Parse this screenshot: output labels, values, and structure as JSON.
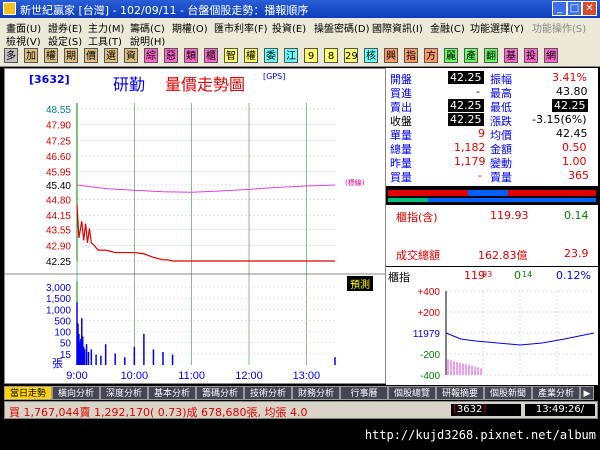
{
  "window": {
    "title": "新世紀贏家 [台灣] - 102/09/11 - 台盤個股走勢：播報順序"
  },
  "menu": {
    "row1": [
      "畫面(U)",
      "證券(E)",
      "主力(M)",
      "籌碼(C)",
      "期權(O)",
      "匯市利率(F)",
      "投資(E)",
      "操盤密碼(D)",
      "國際資訊(I)",
      "金融(C)",
      "功能選擇(Y)",
      "功能操作(S)"
    ],
    "row2": [
      "檢視(V)",
      "設定(S)",
      "工具(T)",
      "說明(H)"
    ]
  },
  "toolbar": {
    "buttons": [
      {
        "label": "多",
        "color": "#c0c0c0"
      },
      {
        "label": "加",
        "color": "#e0c080"
      },
      {
        "label": "權",
        "color": "#e0c080"
      },
      {
        "label": "期",
        "color": "#e0c080"
      },
      {
        "label": "價",
        "color": "#e0c080"
      },
      {
        "label": "選",
        "color": "#e0c080"
      },
      {
        "label": "資",
        "color": "#e0c080"
      },
      {
        "label": "綜",
        "color": "#ff66cc"
      },
      {
        "label": "惡",
        "color": "#ff66cc"
      },
      {
        "label": "類",
        "color": "#ff66cc"
      },
      {
        "label": "櫃",
        "color": "#ff66cc"
      },
      {
        "label": "智",
        "color": "#ffff66"
      },
      {
        "label": "權",
        "color": "#ffff66"
      },
      {
        "label": "委",
        "color": "#66ffff"
      },
      {
        "label": "江",
        "color": "#66ffff"
      },
      {
        "label": "9",
        "color": "#ffff66"
      },
      {
        "label": "8",
        "color": "#ffff66"
      },
      {
        "label": "29",
        "color": "#ffff66"
      },
      {
        "label": "核",
        "color": "#66ffff"
      },
      {
        "label": "興",
        "color": "#ff9966"
      },
      {
        "label": "指",
        "color": "#ff9966"
      },
      {
        "label": "方",
        "color": "#ff9966"
      },
      {
        "label": "麗",
        "color": "#66ff66"
      },
      {
        "label": "產",
        "color": "#66ff66"
      },
      {
        "label": "翻",
        "color": "#66ff66"
      },
      {
        "label": "基",
        "color": "#ff66cc"
      },
      {
        "label": "投",
        "color": "#ff66cc"
      },
      {
        "label": "網",
        "color": "#ff66cc"
      }
    ]
  },
  "chart": {
    "stock_code": "[3632]",
    "stock_name": "研勤",
    "chart_title": "量價走勢圖",
    "gps": "[GPS]",
    "limit_label": "(標線)",
    "forecast_label": "預測",
    "vol_unit": "張"
  },
  "chart_data": {
    "type": "line",
    "title": "量價走勢圖",
    "x_ticks": [
      "9:00",
      "10:00",
      "11:00",
      "12:00",
      "13:00"
    ],
    "price_ticks": [
      48.55,
      47.9,
      47.25,
      46.6,
      45.95,
      45.4,
      44.8,
      44.15,
      43.55,
      42.9,
      42.25
    ],
    "price_ylim": [
      42.25,
      48.55
    ],
    "volume_ticks": [
      3000,
      1500,
      1000,
      500,
      100,
      50,
      15
    ],
    "price_series": {
      "name": "price",
      "x": [
        "9:00",
        "9:02",
        "9:05",
        "9:07",
        "9:09",
        "9:11",
        "9:13",
        "9:15",
        "9:18",
        "9:22",
        "9:30",
        "9:40",
        "9:50",
        "10:00",
        "10:10",
        "10:20",
        "10:25",
        "10:30",
        "10:35",
        "10:40",
        "13:30"
      ],
      "y": [
        44.6,
        43.2,
        43.9,
        43.1,
        43.8,
        43.0,
        43.6,
        43.0,
        42.9,
        42.7,
        42.7,
        42.6,
        42.6,
        42.6,
        42.55,
        42.4,
        42.35,
        42.3,
        42.3,
        42.25,
        42.25
      ]
    },
    "index_series": {
      "name": "index",
      "x": [
        "9:00",
        "9:30",
        "10:00",
        "10:30",
        "11:00",
        "11:30",
        "12:00",
        "12:30",
        "13:00",
        "13:30"
      ],
      "y": [
        45.4,
        45.25,
        45.18,
        45.12,
        45.1,
        45.15,
        45.22,
        45.3,
        45.36,
        45.4
      ]
    },
    "volume_series": {
      "name": "volume",
      "x": [
        "9:00",
        "9:01",
        "9:02",
        "9:03",
        "9:04",
        "9:05",
        "9:06",
        "9:07",
        "9:08",
        "9:10",
        "9:12",
        "9:15",
        "9:20",
        "9:25",
        "9:30",
        "9:40",
        "9:50",
        "10:00",
        "10:10",
        "10:20",
        "10:30",
        "10:40",
        "13:30"
      ],
      "values": [
        120,
        80,
        60,
        45,
        50,
        90,
        55,
        35,
        30,
        40,
        25,
        30,
        20,
        18,
        40,
        22,
        15,
        35,
        60,
        30,
        25,
        20,
        15
      ]
    }
  },
  "quote": {
    "open": {
      "label": "開盤",
      "value": "42.25"
    },
    "amplitude": {
      "label": "振幅",
      "value": "3.41%"
    },
    "bid": {
      "label": "買進",
      "value": "-"
    },
    "high": {
      "label": "最高",
      "value": "43.80"
    },
    "ask": {
      "label": "賣出",
      "value": "42.25"
    },
    "low": {
      "label": "最低",
      "value": "42.25"
    },
    "close": {
      "label": "收盤",
      "value": "42.25"
    },
    "change": {
      "label": "漲跌",
      "value": "-3.15(6%)"
    },
    "unit_vol": {
      "label": "單量",
      "value": "9"
    },
    "avg": {
      "label": "均價",
      "value": "42.45"
    },
    "total_vol": {
      "label": "總量",
      "value": "1,182"
    },
    "amount": {
      "label": "金額",
      "value": "0.50"
    },
    "prev_vol": {
      "label": "昨量",
      "value": "1,179"
    },
    "turnover": {
      "label": "變動",
      "value": "1.00"
    },
    "buy_vol": {
      "label": "買量",
      "value": "-"
    },
    "sell_vol": {
      "label": "賣量",
      "value": "365"
    }
  },
  "otc": {
    "label": "櫃指(含)",
    "value": "119.93",
    "change": "0.14",
    "total_label": "成交總額",
    "total_value": "162.83億",
    "total_change": "23.9"
  },
  "mini": {
    "label": "櫃指",
    "value": "119",
    "value_small": "93",
    "change": "0",
    "change_small": "14",
    "pct": "0.12%",
    "ticks": [
      "+400",
      "+200",
      "11979",
      "-200",
      "-400"
    ]
  },
  "tabs": [
    "當日走勢",
    "橫向分析",
    "深度分析",
    "基本分析",
    "籌碼分析",
    "技術分析",
    "財務分析",
    "行事曆",
    "個股總覽",
    "研報摘要",
    "個股新聞",
    "產業分析"
  ],
  "status": {
    "text": "買 1,767,044賣 1,292,170( 0.73)成 678,680張, 均張 4.0",
    "code": "3632",
    "time": "13:49:26/"
  },
  "watermark": "http://kujd3268.pixnet.net/album"
}
